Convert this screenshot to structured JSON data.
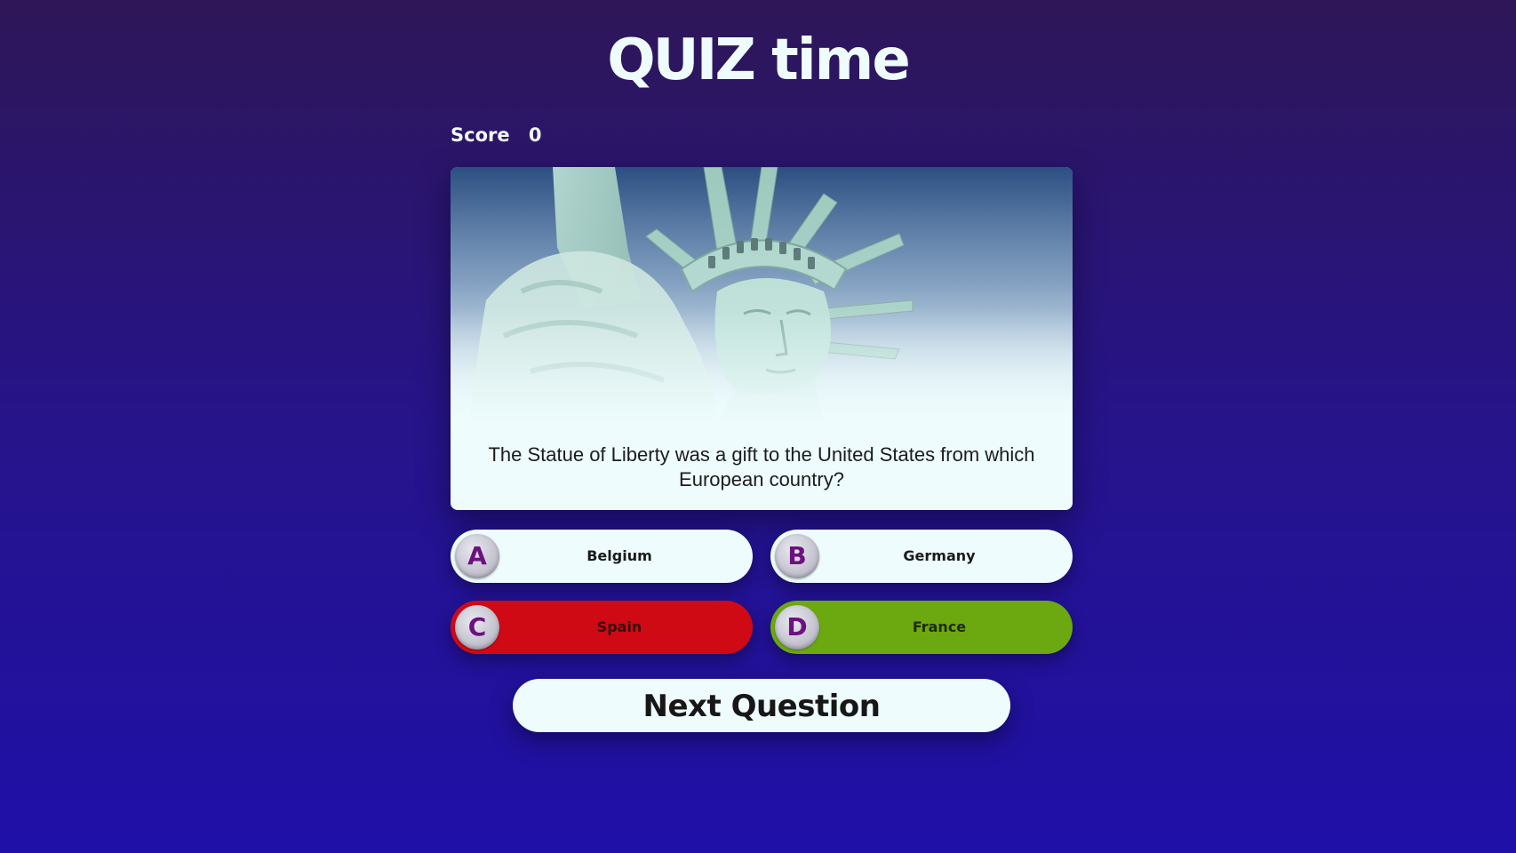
{
  "app": {
    "title_part1": "QUIZ",
    "title_part2": " time"
  },
  "score": {
    "label": "Score",
    "value": "0"
  },
  "question": {
    "image": "statue-of-liberty-image",
    "text": "The Statue of Liberty was a gift to the United States from which European country?"
  },
  "answers": [
    {
      "letter": "A",
      "label": "Belgium",
      "state": "neutral"
    },
    {
      "letter": "B",
      "label": "Germany",
      "state": "neutral"
    },
    {
      "letter": "C",
      "label": "Spain",
      "state": "wrong"
    },
    {
      "letter": "D",
      "label": "France",
      "state": "correct"
    }
  ],
  "next_button": {
    "label": "Next Question"
  },
  "colors": {
    "background_top": "#2e1658",
    "background_bottom": "#1f10a8",
    "card": "#eefcfd",
    "wrong": "#cf0a15",
    "correct": "#6ca910",
    "badge_letter": "#6d1180"
  }
}
